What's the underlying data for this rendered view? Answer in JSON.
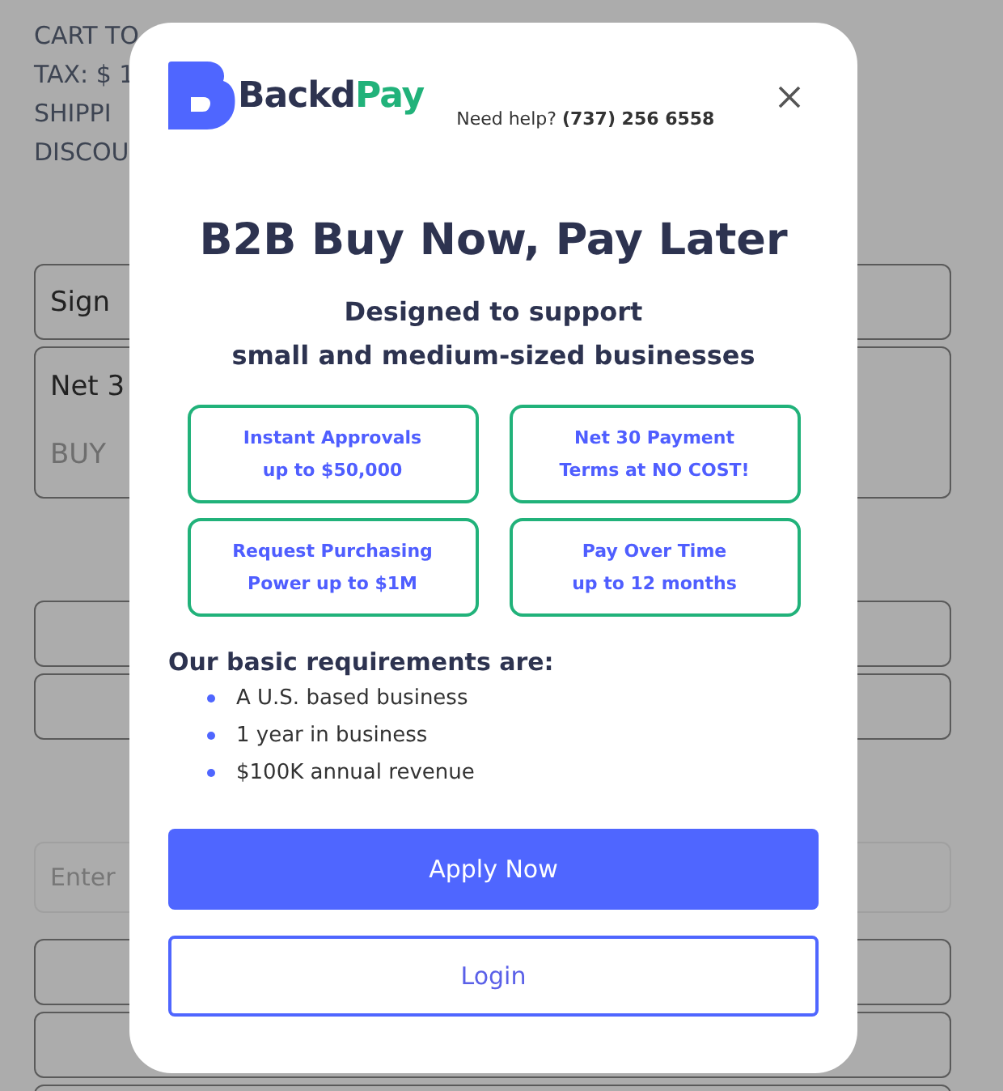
{
  "page": {
    "summary_lines": [
      "CART TO",
      "TAX: $ 1",
      "SHIPPI",
      "DISCOU"
    ],
    "fields": [
      {
        "kind": "box",
        "lines": [
          "Sign"
        ]
      },
      {
        "kind": "tall",
        "lines": [
          "Net 3",
          "BUY"
        ]
      },
      {
        "kind": "spacer"
      },
      {
        "kind": "box"
      },
      {
        "kind": "box"
      },
      {
        "kind": "spacer"
      },
      {
        "kind": "input",
        "placeholder": "Enter"
      },
      {
        "kind": "box"
      },
      {
        "kind": "box"
      },
      {
        "kind": "box"
      }
    ]
  },
  "modal": {
    "brand_first": "Backd",
    "brand_second": "Pay",
    "help": "Need help? **(737) 256 6558**",
    "title": "B2B Buy Now, Pay Later",
    "subtitle_lines": [
      "Designed to support",
      "small and medium-sized businesses"
    ],
    "features": [
      {
        "lines": [
          "Instant Approvals",
          "up to $50,000"
        ]
      },
      {
        "lines": [
          "Net 30 Payment",
          "Terms at NO COST!"
        ]
      },
      {
        "lines": [
          "Request Purchasing",
          "Power up to $1M"
        ]
      },
      {
        "lines": [
          "Pay Over Time",
          "up to 12 months"
        ]
      }
    ],
    "requirements_heading": "Our basic requirements are:",
    "requirements": [
      "A U.S. based business",
      "1 year in business",
      "$100K annual revenue"
    ],
    "buttons": [
      {
        "kind": "primary",
        "label": "Apply Now"
      },
      {
        "kind": "outline",
        "label": "Login"
      }
    ]
  }
}
